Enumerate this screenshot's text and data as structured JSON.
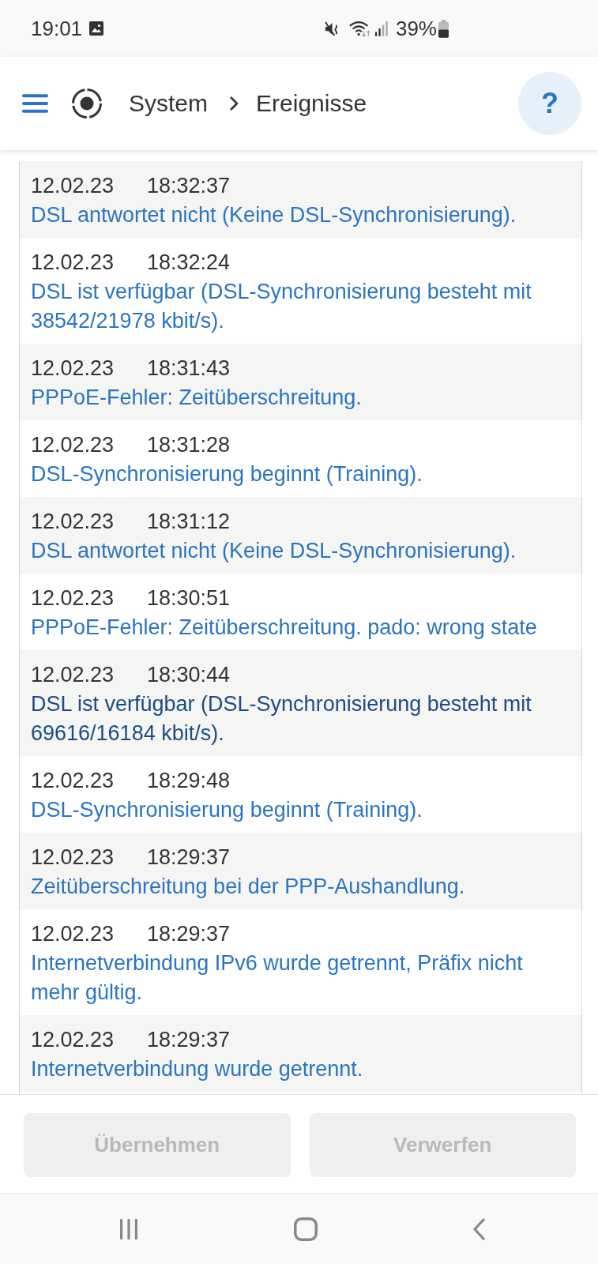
{
  "status_bar": {
    "time": "19:01",
    "battery": "39%"
  },
  "header": {
    "breadcrumb": [
      {
        "label": "System"
      },
      {
        "label": "Ereignisse"
      }
    ],
    "help": "?"
  },
  "events": [
    {
      "date": "12.02.23",
      "time": "18:32:37",
      "message": "DSL antwortet nicht (Keine DSL-Synchronisierung).",
      "visited": false
    },
    {
      "date": "12.02.23",
      "time": "18:32:24",
      "message": "DSL ist verfügbar (DSL-Synchronisierung besteht mit 38542/21978 kbit/s).",
      "visited": false
    },
    {
      "date": "12.02.23",
      "time": "18:31:43",
      "message": "PPPoE-Fehler: Zeitüberschreitung.",
      "visited": false
    },
    {
      "date": "12.02.23",
      "time": "18:31:28",
      "message": "DSL-Synchronisierung beginnt (Training).",
      "visited": false
    },
    {
      "date": "12.02.23",
      "time": "18:31:12",
      "message": "DSL antwortet nicht (Keine DSL-Synchronisierung).",
      "visited": false
    },
    {
      "date": "12.02.23",
      "time": "18:30:51",
      "message": "PPPoE-Fehler: Zeitüberschreitung. pado: wrong state",
      "visited": false
    },
    {
      "date": "12.02.23",
      "time": "18:30:44",
      "message": "DSL ist verfügbar (DSL-Synchronisierung besteht mit 69616/16184 kbit/s).",
      "visited": true
    },
    {
      "date": "12.02.23",
      "time": "18:29:48",
      "message": "DSL-Synchronisierung beginnt (Training).",
      "visited": false
    },
    {
      "date": "12.02.23",
      "time": "18:29:37",
      "message": "Zeitüberschreitung bei der PPP-Aushandlung.",
      "visited": false
    },
    {
      "date": "12.02.23",
      "time": "18:29:37",
      "message": "Internetverbindung IPv6 wurde getrennt, Präfix nicht mehr gültig.",
      "visited": false
    },
    {
      "date": "12.02.23",
      "time": "18:29:37",
      "message": "Internetverbindung wurde getrennt.",
      "visited": false
    }
  ],
  "footer": {
    "buttons": [
      {
        "label": "Übernehmen",
        "disabled": true
      },
      {
        "label": "Verwerfen",
        "disabled": true
      }
    ]
  }
}
